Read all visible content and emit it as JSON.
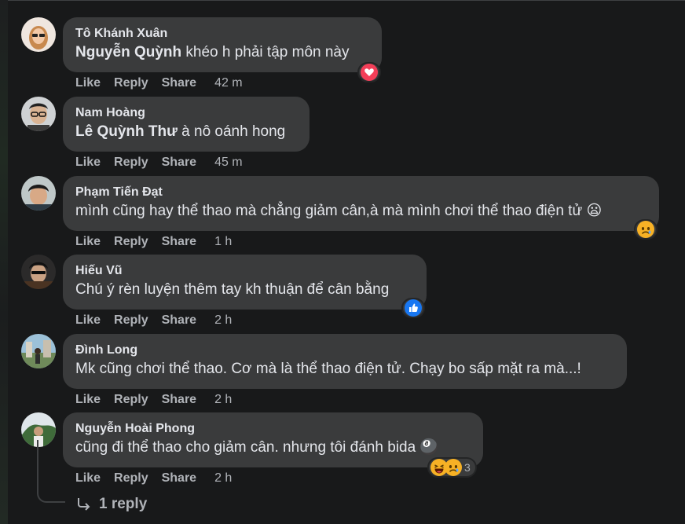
{
  "actions": {
    "like": "Like",
    "reply": "Reply",
    "share": "Share"
  },
  "comments": [
    {
      "author": "Tô Khánh Xuân",
      "mention": "Nguyễn Quỳnh",
      "text": " khéo h phải tập môn này",
      "time": "42 m",
      "reactions": [
        "love"
      ]
    },
    {
      "author": "Nam Hoàng",
      "mention": "Lê Quỳnh Thư",
      "text": " à nô oánh hong",
      "time": "45 m",
      "reactions": []
    },
    {
      "author": "Phạm Tiến Đạt",
      "mention": "",
      "text": "mình cũng hay thể thao mà chẳng giảm cân,à mà mình chơi thể thao điện tử 😦",
      "time": "1 h",
      "reactions": [
        "sad"
      ]
    },
    {
      "author": "Hiếu Vũ",
      "mention": "",
      "text": "Chú ý rèn luyện thêm tay kh thuận để cân bằng",
      "time": "2 h",
      "reactions": [
        "like"
      ]
    },
    {
      "author": "Đình Long",
      "mention": "",
      "text": "Mk cũng chơi thể thao. Cơ mà là thể thao điện tử. Chạy bo sấp mặt ra mà...!",
      "time": "2 h",
      "reactions": []
    },
    {
      "author": "Nguyễn Hoài Phong",
      "mention": "",
      "text": "cũng đi thể thao cho giảm cân. nhưng tôi đánh bida 🎱",
      "time": "2 h",
      "reactions": [
        "haha",
        "sad"
      ],
      "reaction_count": "3"
    }
  ],
  "replies": {
    "label": "1 reply"
  },
  "colors": {
    "background": "#18191a",
    "bubble": "#3a3b3c",
    "text": "#e4e6eb",
    "secondary": "#b0b3b8",
    "like_blue": "#1877f2",
    "love_red": "#f33e58",
    "emoji_yellow": "#f7b125"
  },
  "icons": [
    "love-reaction-icon",
    "sad-reaction-icon",
    "like-reaction-icon",
    "haha-reaction-icon",
    "reply-arrow-icon"
  ]
}
